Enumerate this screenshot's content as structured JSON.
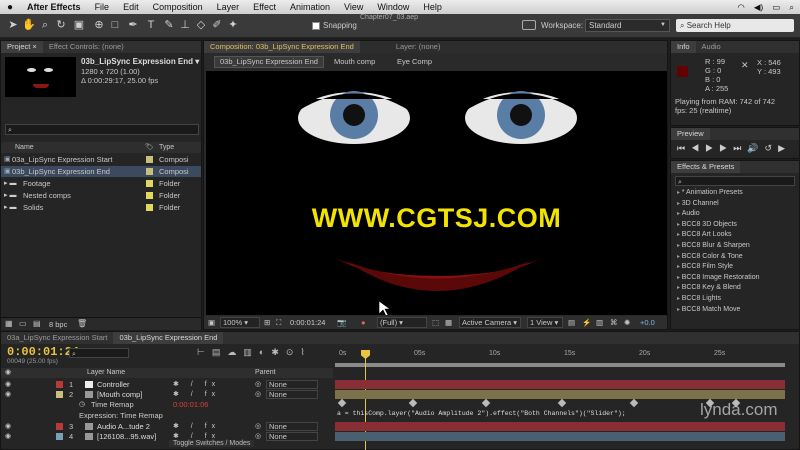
{
  "menubar": {
    "apple": "",
    "app": "After Effects",
    "items": [
      "File",
      "Edit",
      "Composition",
      "Layer",
      "Effect",
      "Animation",
      "View",
      "Window",
      "Help"
    ],
    "right_icons": [
      "wifi-icon",
      "volume-icon",
      "battery-icon",
      "search-spotlight-icon"
    ]
  },
  "toolbar": {
    "title": "Chapter07_03.aep",
    "snapping": "Snapping",
    "workspace_label": "Workspace:",
    "workspace_value": "Standard",
    "search_help_placeholder": "Search Help"
  },
  "project": {
    "tabs": [
      "Project ×",
      "Effect Controls: (none)"
    ],
    "selected_name": "03b_LipSync Expression End ▾",
    "selected_size": "1280 x 720 (1.00)",
    "selected_duration": "Δ 0:00:29:17, 25.00 fps",
    "search_placeholder": "",
    "col_name": "Name",
    "col_type": "Type",
    "items": [
      {
        "name": "03a_LipSync Expression Start",
        "type": "Composi",
        "color": "#c8c07a",
        "kind": "comp"
      },
      {
        "name": "03b_LipSync Expression End",
        "type": "Composi",
        "color": "#c8c07a",
        "kind": "comp"
      },
      {
        "name": "Footage",
        "type": "Folder",
        "color": "#e0d85a",
        "kind": "folder"
      },
      {
        "name": "Nested comps",
        "type": "Folder",
        "color": "#e0d85a",
        "kind": "folder"
      },
      {
        "name": "Solids",
        "type": "Folder",
        "color": "#e0d85a",
        "kind": "folder"
      }
    ],
    "bpc": "8 bpc"
  },
  "composition": {
    "tab": "Composition: 03b_LipSync Expression End",
    "layer_tab": "Layer: (none)",
    "subtabs": [
      "03b_LipSync Expression End",
      "Mouth comp",
      "Eye Comp"
    ],
    "watermark": "WWW.CGTSJ.COM",
    "zoom": "100%",
    "timecode": "0:00:01:24",
    "resolution": "(Full)",
    "camera": "Active Camera",
    "views": "1 View",
    "exposure": "+0.0"
  },
  "info": {
    "tabs": [
      "Info",
      "Audio"
    ],
    "r": "R : 99",
    "g": "G : 0",
    "b": "B : 0",
    "a": "A : 255",
    "x": "X : 546",
    "y": "Y : 493",
    "swatch": "#630000",
    "playing": "Playing from RAM: 742 of 742",
    "fps": "fps: 25 (realtime)"
  },
  "preview": {
    "tab": "Preview"
  },
  "effects": {
    "tab": "Effects & Presets",
    "search_placeholder": "",
    "items": [
      "* Animation Presets",
      "3D Channel",
      "Audio",
      "BCC8 3D Objects",
      "BCC8 Art Looks",
      "BCC8 Blur & Sharpen",
      "BCC8 Color & Tone",
      "BCC8 Film Style",
      "BCC8 Image Restoration",
      "BCC8 Key & Blend",
      "BCC8 Lights",
      "BCC8 Match Move"
    ]
  },
  "timeline": {
    "tabs": [
      "03a_LipSync Expression Start",
      "03b_LipSync Expression End"
    ],
    "timecode": "0:00:01:24",
    "frames": "00049 (25.00 fps)",
    "col_layer_name": "Layer Name",
    "col_parent": "Parent",
    "ruler": [
      "0s",
      "05s",
      "10s",
      "15s",
      "20s",
      "25s"
    ],
    "layers": [
      {
        "num": "1",
        "name": "Controller",
        "parent": "None",
        "color": "#b83a3a"
      },
      {
        "num": "2",
        "name": "[Mouth comp]",
        "parent": "None",
        "color": "#c8c07a"
      },
      {
        "num": "",
        "name": "Time Remap",
        "parent": "",
        "value": "0:00:01:06",
        "color": ""
      },
      {
        "num": "",
        "name": "Expression: Time Remap",
        "parent": "",
        "color": ""
      },
      {
        "num": "3",
        "name": "Audio A...tude 2",
        "parent": "None",
        "color": "#b83a3a"
      },
      {
        "num": "4",
        "name": "[126108...95.wav]",
        "parent": "None",
        "color": "#7aa0b8"
      }
    ],
    "expression": "a = thisComp.layer(\"Audio Amplitude 2\").effect(\"Both Channels\")(\"Slider\");",
    "toggle_switches": "Toggle Switches / Modes"
  },
  "branding": {
    "logo": "lynda.com"
  }
}
